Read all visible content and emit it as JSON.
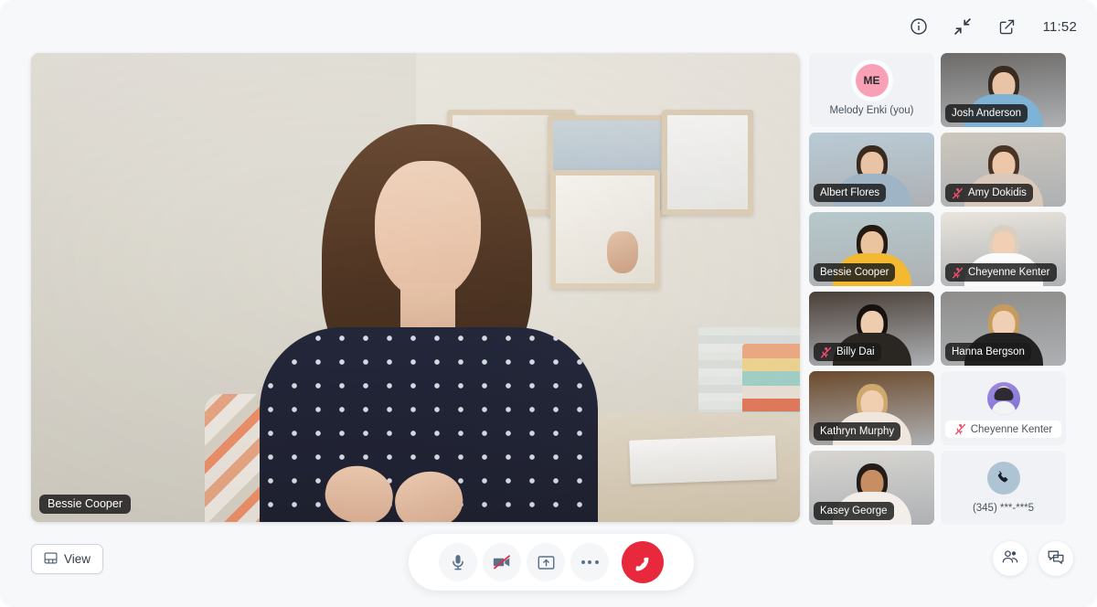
{
  "app": {
    "background_color": "#f7f8fa",
    "accent_end_call": "#e8283c",
    "icon_color": "#5b718b"
  },
  "topbar": {
    "info_icon": "info-circle-icon",
    "collapse_icon": "collapse-arrows-icon",
    "popout_icon": "external-link-icon",
    "clock": "11:52"
  },
  "stage": {
    "speaker_name": "Bessie Cooper",
    "muted": false
  },
  "grid": {
    "participants": [
      {
        "name": "Melody Enki (you)",
        "kind": "avatar",
        "avatar_type": "initials",
        "initials": "ME",
        "avatar_color": "#f8a0b5",
        "muted": false,
        "label_style": "card"
      },
      {
        "name": "Josh Anderson",
        "kind": "video",
        "muted": false,
        "label_style": "chip",
        "bg": "#6c6a68",
        "skin": "#e8c3a6",
        "hair": "#3a2b20",
        "shirt": "#7fb3d5"
      },
      {
        "name": "Albert Flores",
        "kind": "video",
        "muted": false,
        "label_style": "chip",
        "bg": "#b9cbd6",
        "skin": "#e8c3a6",
        "hair": "#3a2a1e",
        "shirt": "#9fb4c4"
      },
      {
        "name": "Amy Dokidis",
        "kind": "video",
        "muted": true,
        "label_style": "chip",
        "bg": "#cdc7bd",
        "skin": "#edc7a9",
        "hair": "#4a3426",
        "shirt": "#d8c9ba"
      },
      {
        "name": "Bessie Cooper",
        "kind": "video",
        "muted": false,
        "label_style": "chip",
        "bg": "#b6c9cc",
        "skin": "#e9c49f",
        "hair": "#241a14",
        "shirt": "#f2b931"
      },
      {
        "name": "Cheyenne Kenter",
        "kind": "video",
        "muted": true,
        "label_style": "chip",
        "bg": "#e9e5dd",
        "skin": "#f0cfb4",
        "hair": "#d8cfc0",
        "shirt": "#fbfbfb"
      },
      {
        "name": "Billy Dai",
        "kind": "video",
        "muted": true,
        "label_style": "chip",
        "bg": "#4a3f38",
        "skin": "#edcdae",
        "hair": "#171210",
        "shirt": "#2a2622"
      },
      {
        "name": "Hanna Bergson",
        "kind": "video",
        "muted": false,
        "label_style": "chip",
        "bg": "#8d8c8a",
        "skin": "#f0d0b4",
        "hair": "#c79a5e",
        "shirt": "#222222"
      },
      {
        "name": "Kathryn Murphy",
        "kind": "video",
        "muted": false,
        "label_style": "chip",
        "bg": "#6b4a2c",
        "skin": "#f0cfb1",
        "hair": "#cfa86e",
        "shirt": "#efe7dd"
      },
      {
        "name": "Cheyenne Kenter",
        "kind": "avatar",
        "avatar_type": "photo",
        "avatar_color": "#8271d6",
        "muted": true,
        "label_style": "card"
      },
      {
        "name": "Kasey George",
        "kind": "video",
        "muted": false,
        "label_style": "chip",
        "bg": "#d7d6d2",
        "skin": "#c68e62",
        "hair": "#241c18",
        "shirt": "#f3eee9"
      },
      {
        "name": "(345) ***-***5",
        "kind": "phone",
        "avatar_type": "phone",
        "avatar_color": "#aec3d4",
        "muted": false,
        "label_style": "plain"
      }
    ]
  },
  "controls": {
    "view_label": "View",
    "view_icon": "layout-grid-icon",
    "mic_icon": "microphone-icon",
    "mic_state": "on",
    "camera_icon": "camera-off-icon",
    "camera_state": "off",
    "share_icon": "share-screen-icon",
    "more_icon": "more-options-icon",
    "end_call_icon": "end-call-icon",
    "participants_icon": "participants-icon",
    "chat_icon": "chat-icon"
  }
}
